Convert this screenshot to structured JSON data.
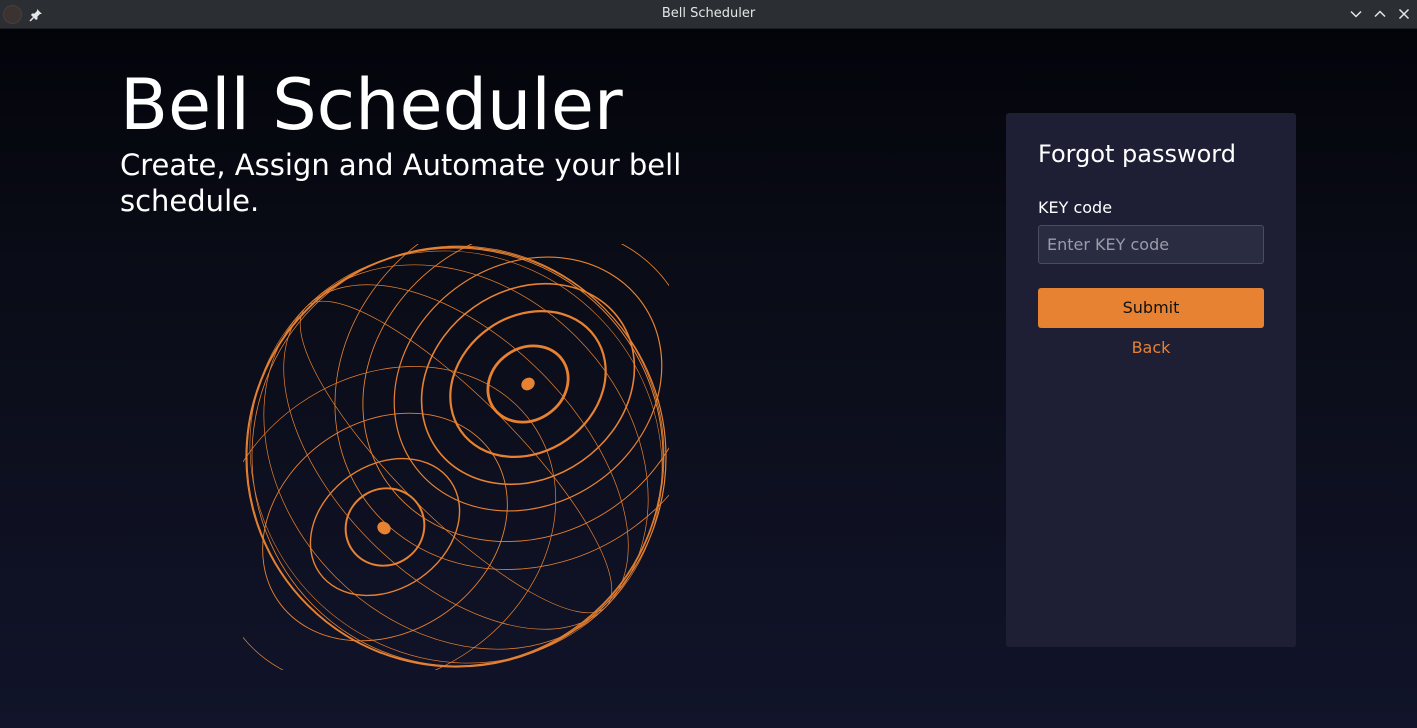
{
  "window": {
    "title": "Bell Scheduler"
  },
  "hero": {
    "title": "Bell Scheduler",
    "subtitle": "Create, Assign and Automate your bell schedule."
  },
  "forgot_password": {
    "title": "Forgot password",
    "key_label": "KEY code",
    "key_placeholder": "Enter KEY code",
    "key_value": "",
    "submit_label": "Submit",
    "back_label": "Back"
  },
  "colors": {
    "accent": "#e78232",
    "card_bg": "#1e1f35",
    "titlebar_bg": "#2b2e33"
  },
  "icons": {
    "app": "app-icon",
    "pin": "pin-icon",
    "minimize": "chevron-down-icon",
    "maximize": "chevron-up-icon",
    "close": "close-icon",
    "illustration": "orange-wireframe-globe"
  }
}
